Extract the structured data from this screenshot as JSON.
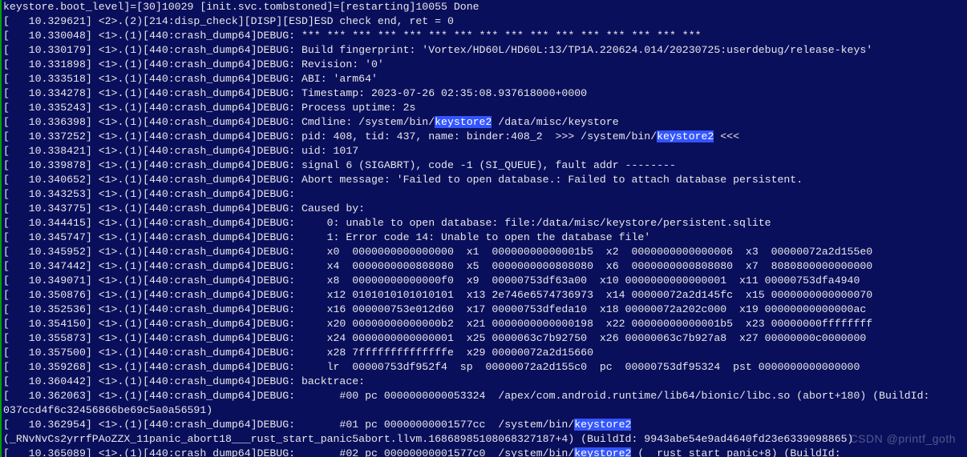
{
  "terminal": {
    "highlight_word": "keystore2",
    "lines": [
      {
        "t": "keystore.boot_level]=[30]10029 [init.svc.tombstoned]=[restarting]10055 Done"
      },
      {
        "t": "[   10.329621] <2>.(2)[214:disp_check][DISP][ESD]ESD check end, ret = 0"
      },
      {
        "t": "[   10.330048] <1>.(1)[440:crash_dump64]DEBUG: *** *** *** *** *** *** *** *** *** *** *** *** *** *** *** ***"
      },
      {
        "t": "[   10.330179] <1>.(1)[440:crash_dump64]DEBUG: Build fingerprint: 'Vortex/HD60L/HD60L:13/TP1A.220624.014/20230725:userdebug/release-keys'"
      },
      {
        "t": "[   10.331898] <1>.(1)[440:crash_dump64]DEBUG: Revision: '0'"
      },
      {
        "t": "[   10.333518] <1>.(1)[440:crash_dump64]DEBUG: ABI: 'arm64'"
      },
      {
        "t": "[   10.334278] <1>.(1)[440:crash_dump64]DEBUG: Timestamp: 2023-07-26 02:35:08.937618000+0000"
      },
      {
        "t": "[   10.335243] <1>.(1)[440:crash_dump64]DEBUG: Process uptime: 2s"
      },
      {
        "t": "[   10.336398] <1>.(1)[440:crash_dump64]DEBUG: Cmdline: /system/bin/{{HL}} /data/misc/keystore"
      },
      {
        "t": "[   10.337252] <1>.(1)[440:crash_dump64]DEBUG: pid: 408, tid: 437, name: binder:408_2  >>> /system/bin/{{HL}} <<<"
      },
      {
        "t": "[   10.338421] <1>.(1)[440:crash_dump64]DEBUG: uid: 1017"
      },
      {
        "t": "[   10.339878] <1>.(1)[440:crash_dump64]DEBUG: signal 6 (SIGABRT), code -1 (SI_QUEUE), fault addr --------"
      },
      {
        "t": "[   10.340652] <1>.(1)[440:crash_dump64]DEBUG: Abort message: 'Failed to open database.: Failed to attach database persistent."
      },
      {
        "t": "[   10.343253] <1>.(1)[440:crash_dump64]DEBUG: "
      },
      {
        "t": "[   10.343775] <1>.(1)[440:crash_dump64]DEBUG: Caused by:"
      },
      {
        "t": "[   10.344415] <1>.(1)[440:crash_dump64]DEBUG:     0: unable to open database: file:/data/misc/keystore/persistent.sqlite"
      },
      {
        "t": "[   10.345747] <1>.(1)[440:crash_dump64]DEBUG:     1: Error code 14: Unable to open the database file'"
      },
      {
        "t": "[   10.345952] <1>.(1)[440:crash_dump64]DEBUG:     x0  0000000000000000  x1  00000000000001b5  x2  0000000000000006  x3  00000072a2d155e0"
      },
      {
        "t": "[   10.347442] <1>.(1)[440:crash_dump64]DEBUG:     x4  0000000000808080  x5  0000000000808080  x6  0000000000808080  x7  8080800000000000"
      },
      {
        "t": "[   10.349071] <1>.(1)[440:crash_dump64]DEBUG:     x8  00000000000000f0  x9  00000753df63a00  x10 0000000000000001  x11 00000753dfa4940"
      },
      {
        "t": "[   10.350876] <1>.(1)[440:crash_dump64]DEBUG:     x12 0101010101010101  x13 2e746e6574736973  x14 00000072a2d145fc  x15 0000000000000070"
      },
      {
        "t": "[   10.352536] <1>.(1)[440:crash_dump64]DEBUG:     x16 000000753e012d60  x17 00000753dfeda10  x18 00000072a202c000  x19 00000000000000ac"
      },
      {
        "t": "[   10.354150] <1>.(1)[440:crash_dump64]DEBUG:     x20 00000000000000b2  x21 0000000000000198  x22 00000000000001b5  x23 00000000ffffffff"
      },
      {
        "t": "[   10.355873] <1>.(1)[440:crash_dump64]DEBUG:     x24 0000000000000001  x25 0000063c7b92750  x26 00000063c7b927a8  x27 00000000c0000000"
      },
      {
        "t": "[   10.357500] <1>.(1)[440:crash_dump64]DEBUG:     x28 7ffffffffffffffe  x29 00000072a2d15660"
      },
      {
        "t": "[   10.359268] <1>.(1)[440:crash_dump64]DEBUG:     lr  00000753df952f4  sp  00000072a2d155c0  pc  00000753df95324  pst 0000000000000000"
      },
      {
        "t": "[   10.360442] <1>.(1)[440:crash_dump64]DEBUG: backtrace:"
      },
      {
        "t": "[   10.362063] <1>.(1)[440:crash_dump64]DEBUG:       #00 pc 0000000000053324  /apex/com.android.runtime/lib64/bionic/libc.so (abort+180) (BuildId:"
      },
      {
        "t": "037ccd4f6c32456866be69c5a0a56591)"
      },
      {
        "t": "[   10.362954] <1>.(1)[440:crash_dump64]DEBUG:       #01 pc 00000000001577cc  /system/bin/{{HL}}"
      },
      {
        "t": "(_RNvNvCs2yrrfPAoZZX_11panic_abort18___rust_start_panic5abort.llvm.16868985108068327187+4) (BuildId: 9943abe54e9ad4640fd23e6339098865)"
      },
      {
        "t": "[   10.365089] <1>.(1)[440:crash_dump64]DEBUG:       #02 pc 00000000001577c0  /system/bin/{{HL}} (__rust_start_panic+8) (BuildId:"
      }
    ]
  },
  "watermark": "CSDN @printf_goth"
}
